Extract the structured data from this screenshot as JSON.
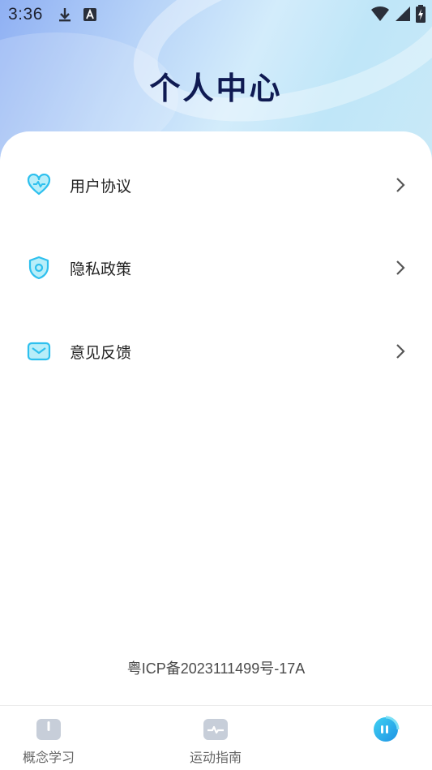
{
  "status_bar": {
    "time": "3:36",
    "icons": [
      "download-icon",
      "font-a-icon",
      "wifi-icon",
      "signal-icon",
      "battery-charging-icon"
    ]
  },
  "header": {
    "title": "个人中心"
  },
  "menu": {
    "items": [
      {
        "label": "用户协议",
        "icon": "heart-hands-icon"
      },
      {
        "label": "隐私政策",
        "icon": "shield-icon"
      },
      {
        "label": "意见反馈",
        "icon": "mail-icon"
      }
    ]
  },
  "footer": {
    "icp": "粤ICP备2023111499号-17A"
  },
  "tabbar": {
    "tabs": [
      {
        "label": "概念学习",
        "icon": "book-icon",
        "active": false
      },
      {
        "label": "运动指南",
        "icon": "pulse-icon",
        "active": false
      },
      {
        "label": "",
        "icon": "profile-bubble-icon",
        "active": true
      }
    ]
  },
  "colors": {
    "accent": "#2ec0ee",
    "title": "#0f1a52",
    "icon_gray": "#c7ced9"
  }
}
